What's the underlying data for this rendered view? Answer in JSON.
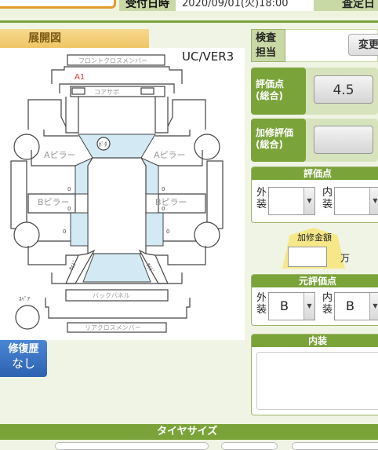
{
  "header": {
    "received_label": "受付日時",
    "received_value": "2020/09/01(火)18:00",
    "inspection_label": "査定日"
  },
  "diagram": {
    "tab_label": "展開図",
    "version": "UC/VER3",
    "parts": {
      "front_cross_member": "フロントクロスメンバー",
      "core_support": "コアサポ",
      "a_pillar_left": "Aピラー",
      "a_pillar_right": "Aピラー",
      "b_pillar_left": "Bピラー",
      "b_pillar_right": "Bピラー",
      "dash": "ﾀﾞｯｼｭ",
      "back_panel": "バックパネル",
      "rear_cross_member": "リアクロスメンバー",
      "spare": "ｽﾍﾟｱ",
      "left_side": "ｻｲﾄﾞ",
      "right_side": "ｻｲﾄﾞ"
    },
    "marks": [
      {
        "code": "A1",
        "part": "front_cross_member"
      },
      {
        "code": "ﾎﾞﾀ",
        "part": "roof"
      }
    ]
  },
  "repair_history": {
    "label": "修復歴",
    "value": "なし"
  },
  "inspector": {
    "label": "検査担当",
    "label_line1": "検査",
    "label_line2": "担当",
    "change_button": "変更"
  },
  "overall_score": {
    "label_line1": "評価点",
    "label_line2": "(総合)",
    "value": "4.5"
  },
  "repair_score": {
    "label_line1": "加修評価",
    "label_line2": "(総合)",
    "value": ""
  },
  "score_detail": {
    "title": "評価点",
    "exterior_line1": "外",
    "exterior_line2": "装",
    "exterior_value": "",
    "interior_line1": "内",
    "interior_line2": "装",
    "interior_value": ""
  },
  "repair_cost": {
    "label": "加修金額",
    "value": "",
    "unit": "万"
  },
  "original_score": {
    "title": "元評価点",
    "exterior_line1": "外",
    "exterior_line2": "装",
    "exterior_value": "B",
    "interior_line1": "内",
    "interior_line2": "装",
    "interior_value": "B"
  },
  "interior": {
    "title": "内装",
    "notes": ""
  },
  "tire": {
    "title": "タイヤサイズ"
  },
  "colors": {
    "accent_green": "#7aa33a",
    "label_green": "#c9d9a6",
    "tab_orange": "#efc565",
    "history_blue": "#2c62b0",
    "highlight_yellow": "#f6e889"
  }
}
